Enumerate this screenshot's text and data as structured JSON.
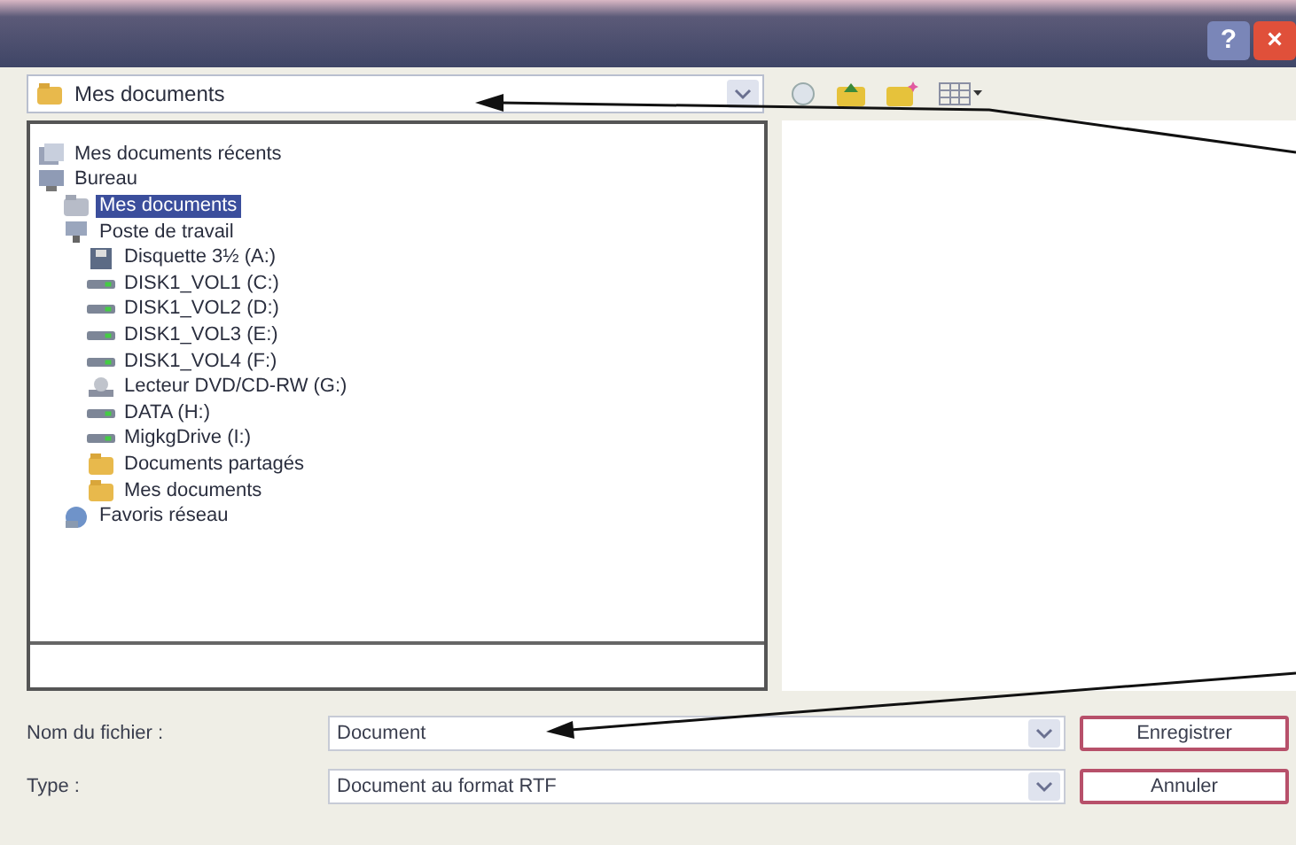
{
  "window": {
    "title_buttons": [
      {
        "kind": "help",
        "label": "?"
      },
      {
        "kind": "close",
        "label": "×"
      }
    ]
  },
  "location": {
    "value": "Mes documents"
  },
  "toolbar": [
    {
      "kind": "back"
    },
    {
      "kind": "up"
    },
    {
      "kind": "newfolder"
    },
    {
      "kind": "views"
    }
  ],
  "dropdown": {
    "items": [
      {
        "label": "Mes documents récents",
        "kind": "recent",
        "selected": false
      },
      {
        "label": "Bureau",
        "kind": "desktop",
        "selected": false,
        "children": [
          {
            "label": "Mes documents",
            "kind": "documents",
            "selected": true
          },
          {
            "label": "Poste de travail",
            "kind": "computer",
            "selected": false,
            "children": [
              {
                "label": "Disquette 3½ (A:)",
                "kind": "floppy",
                "selected": false
              },
              {
                "label": "DISK1_VOL1 (C:)",
                "kind": "disk",
                "selected": false
              },
              {
                "label": "DISK1_VOL2 (D:)",
                "kind": "disk",
                "selected": false
              },
              {
                "label": "DISK1_VOL3 (E:)",
                "kind": "disk",
                "selected": false
              },
              {
                "label": "DISK1_VOL4 (F:)",
                "kind": "disk",
                "selected": false
              },
              {
                "label": "Lecteur DVD/CD-RW (G:)",
                "kind": "cd",
                "selected": false
              },
              {
                "label": "DATA (H:)",
                "kind": "disk",
                "selected": false
              },
              {
                "label": "MigkgDrive (I:)",
                "kind": "disk",
                "selected": false
              },
              {
                "label": "Documents partagés",
                "kind": "folder",
                "selected": false
              },
              {
                "label": "Mes documents",
                "kind": "folder",
                "selected": false
              }
            ]
          },
          {
            "label": "Favoris réseau",
            "kind": "network",
            "selected": false
          }
        ]
      }
    ]
  },
  "fields": [
    {
      "label": "Nom du fichier :",
      "value": "Document",
      "button": "Enregistrer"
    },
    {
      "label": "Type :",
      "value": "Document au format RTF",
      "button": "Annuler"
    }
  ]
}
